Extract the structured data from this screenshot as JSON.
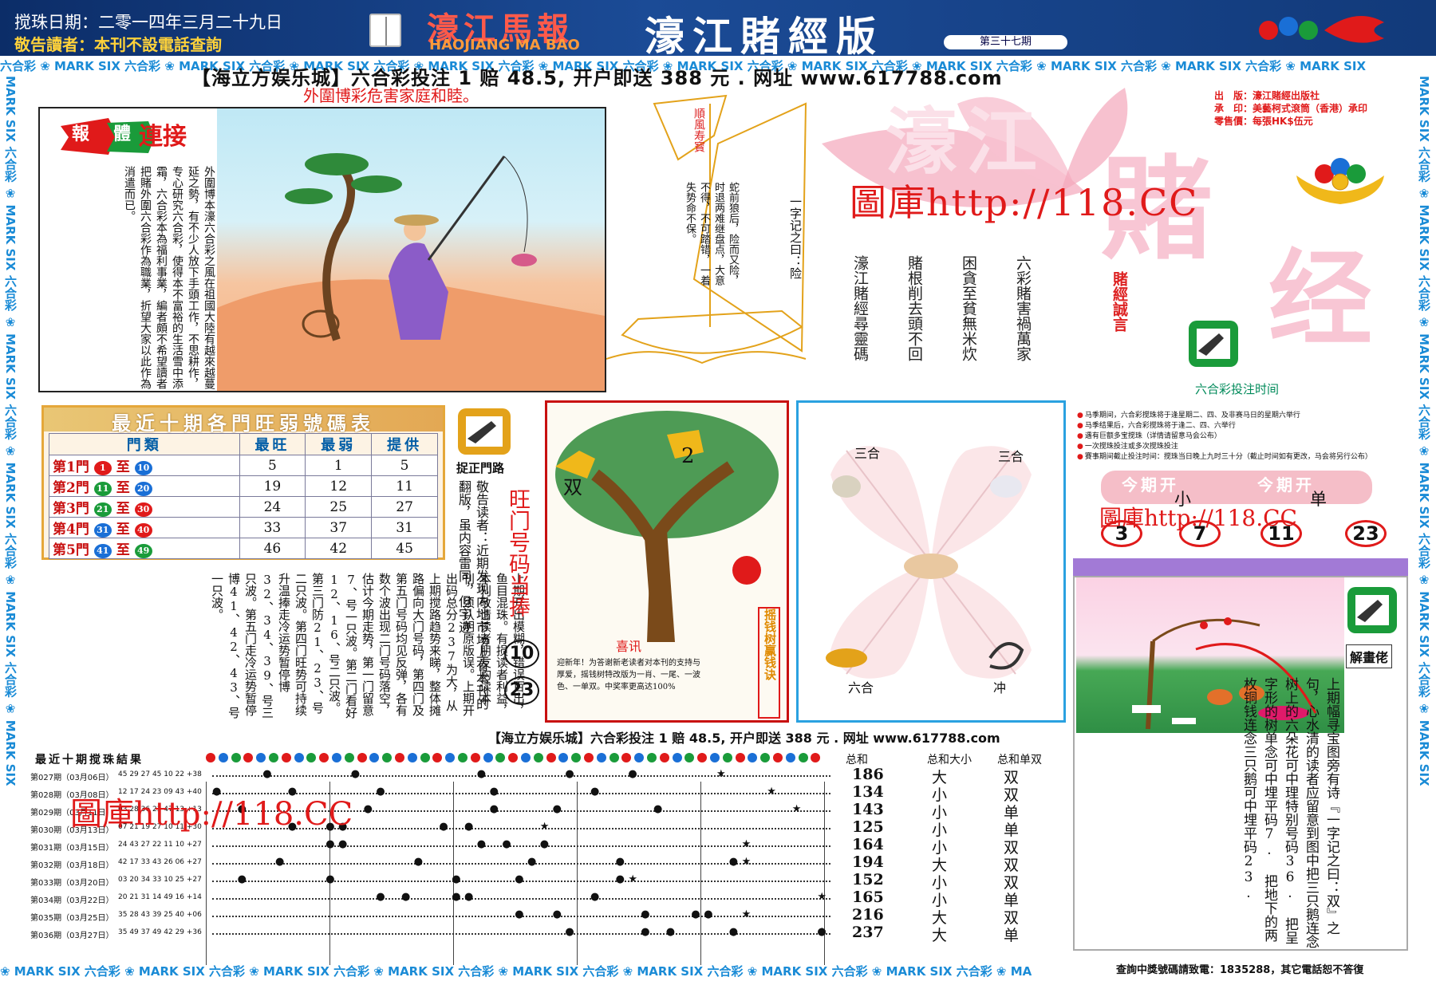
{
  "header": {
    "date": "搅珠日期：二零一四年三月二十九日",
    "warning_prefix": "敬告讀者：",
    "warning_text": "本刊不設電話查詢",
    "logo_name": "濠江馬報",
    "logo_pinyin": "HAOJIANG MA BAO",
    "edition": "濠江賭經版",
    "issue": "第三十七期"
  },
  "strips": {
    "top": "六合彩 ❀ MARK SIX 六合彩 ❀ MARK SIX 六合彩 ❀ MARK SIX 六合彩 ❀ MARK SIX 六合彩 ❀ MARK SIX 六合彩 ❀ MARK SIX 六合彩 ❀ MARK SIX 六合彩 ❀ MARK SIX 六合彩 ❀ MARK SIX 六合彩 ❀ MARK SIX 六合彩 ❀ MARK SIX",
    "bottom": "❀ MARK SIX 六合彩 ❀ MARK SIX 六合彩 ❀ MARK SIX 六合彩 ❀ MARK SIX 六合彩 ❀ MARK SIX 六合彩 ❀ MARK SIX 六合彩 ❀ MARK SIX 六合彩 ❀ MARK SIX 六合彩 ❀ MA",
    "side": "MARK SIX 六合彩 ❀ MARK SIX 六合彩 ❀ MARK SIX 六合彩 ❀ MARK SIX 六合彩 ❀ MARK SIX 六合彩 ❀ MARK SIX"
  },
  "ad_top": "【海立方娱乐城】六合彩投注 1 赔 48.5, 开户即送 388 元 . 网址 www.617788.com",
  "subhead": "外圍博彩危害家庭和睦。",
  "comic": {
    "tag_a": "報",
    "tag_b": "體",
    "tag_c": "連接",
    "text": "外圍博本濠六合彩之風在祖國大陸有越來越蔓延之勢，有不少人放下手頭工作，不思耕作，专心研究六合彩，使得本不富裕的生活雪中添霜，六合彩本為福利事業，編者頗不希望讀者把賭外圍六合彩作為職業，折望大家以此作為消遣而已。"
  },
  "boat": {
    "flag": "順風寿寳",
    "text1": "一字记之曰：险",
    "text2": "蛇前狼后，险而又险，时退两难继盘点，大意不得，不可踏错，一着失势命不保。"
  },
  "masthead": {
    "pub_label1": "出　版：",
    "pub_value1": "濠江賭經出版社",
    "pub_label2": "承　印：",
    "pub_value2": "美藝柯式滾筒（香港）承印",
    "pub_label3": "零售價：",
    "pub_value3": "每張HK$伍元",
    "big_a": "濠江",
    "big_b": "賭",
    "big_c": "经",
    "watermark": "圖庫http://118.CC",
    "poem": [
      "六彩賭害禍萬家",
      "困貪至貧無米炊",
      "賭根削去頭不回",
      "濠江賭經尋靈碼"
    ],
    "poem_label": "賭經誠言",
    "bet_time": "六合彩投注时间"
  },
  "stats": {
    "title": "最近十期各門旺弱號碼表",
    "headers": [
      "門類",
      "最旺",
      "最弱",
      "提供"
    ],
    "zhi": "至",
    "rows": [
      {
        "gate": "第1門",
        "from": "1",
        "to": "10",
        "hot": "5",
        "cold": "1",
        "pick": "5",
        "c1": "#e01a1a",
        "c2": "#1a6fd6"
      },
      {
        "gate": "第2門",
        "from": "11",
        "to": "20",
        "hot": "19",
        "cold": "12",
        "pick": "11",
        "c1": "#1a9b3a",
        "c2": "#1a6fd6"
      },
      {
        "gate": "第3門",
        "from": "21",
        "to": "30",
        "hot": "24",
        "cold": "25",
        "pick": "27",
        "c1": "#1a9b3a",
        "c2": "#e01a1a"
      },
      {
        "gate": "第4門",
        "from": "31",
        "to": "40",
        "hot": "33",
        "cold": "37",
        "pick": "31",
        "c1": "#1a6fd6",
        "c2": "#e01a1a"
      },
      {
        "gate": "第5門",
        "from": "41",
        "to": "49",
        "hot": "46",
        "cold": "42",
        "pick": "45",
        "c1": "#1a6fd6",
        "c2": "#1a9b3a"
      }
    ]
  },
  "hand_label": "捉正門路",
  "mid_text": "上期开出模糊，错误百出，鱼目混珠。有损读者利益，本刊敬请读者朋友购读本刊，须认明原版误。上期开出码总分237为大，从上期搅路趋势来睇，整体摊路偏向大门号码，第四门及第五门号码均见反弹，各有数个波出现二门号码落空，估计今期走势，第一门留意7、号一只波。第二门看好12、16、号二只波。第三门防21、23、号二只波。第四门旺势可持续升温捧走冷运势暂停博32、34、39、号三只波。第五门走冷运势暂停博41、42、43、号一只波。",
  "notice_text": "敬告读者：近期发现内地市场上有本刊的翻版，虽内容雷同，但字迹",
  "hot": {
    "title": "旺门号码当捧",
    "n1": "10",
    "n2": "23"
  },
  "tree": {
    "label_a": "双",
    "label_b": "2",
    "cap_title": "喜讯",
    "cap_text": "迎新年！为答谢新老读者对本刊的支持与厚爱，摇钱树特改版为一肖、一尾、一波色、一单双。中奖率更高达100%",
    "side": "摇钱树赢钱诀"
  },
  "heart": {
    "tl": "三合",
    "tr": "三合",
    "bl": "六合",
    "br": "冲"
  },
  "bet_notes": [
    "马季期间，六合彩搅珠将于逢星期二、四、及非赛马日的星期六举行",
    "马季结果后，六合彩搅珠将于逢二、四、六举行",
    "遇有巨额多宝搅珠（详情请留意马会公布）",
    "一次搅珠投注或多次搅珠投注",
    "賽事期间截止投注时间：搅珠当日晚上九时三十分（截止时间如有更改，马会将另行公布）"
  ],
  "open": {
    "label": "今期开",
    "val1": "小",
    "val2": "单",
    "watermark": "圖庫http://118.CC",
    "nums": [
      "3",
      "7",
      "11",
      "23"
    ]
  },
  "riddle": {
    "label": "解畫佬",
    "text": "上期幅寻宝图旁有诗『一字记之曰：双』之句，心水清的读者应留意到图中把三只鹅连念树上的六朵花可中理特别号码36. 把呈字形的树单念可中埋平码7. 把地下的两枚铜钱连念三只鹅可中埋平码23."
  },
  "results": {
    "head": "最近十期搅珠結果",
    "col_sum": "总和",
    "col_bs": "总和大小",
    "col_oe": "总和单双",
    "rows": [
      {
        "label": "第027期（03月06日）",
        "nums": "45 29 27 45 10 22 +38",
        "sum": "186",
        "bs": "大",
        "oe": "双"
      },
      {
        "label": "第028期（03月08日）",
        "nums": "12 17 24 23 09 43 +40",
        "sum": "134",
        "bs": "小",
        "oe": "双"
      },
      {
        "label": "第029期（03月11日）",
        "nums": "03 28 36 23 47 13 +13",
        "sum": "143",
        "bs": "小",
        "oe": "单"
      },
      {
        "label": "第030期（03月13日）",
        "nums": "07 21 19 27 10 11 +30",
        "sum": "125",
        "bs": "小",
        "oe": "单"
      },
      {
        "label": "第031期（03月15日）",
        "nums": "24 43 27 22 11 10 +27",
        "sum": "164",
        "bs": "小",
        "oe": "双"
      },
      {
        "label": "第032期（03月18日）",
        "nums": "42 17 33 43 26 06 +27",
        "sum": "194",
        "bs": "大",
        "oe": "双"
      },
      {
        "label": "第033期（03月20日）",
        "nums": "03 20 34 33 10 25 +27",
        "sum": "152",
        "bs": "小",
        "oe": "双"
      },
      {
        "label": "第034期（03月22日）",
        "nums": "20 21 31 14 49 16 +14",
        "sum": "165",
        "bs": "小",
        "oe": "单"
      },
      {
        "label": "第035期（03月25日）",
        "nums": "35 28 43 39 25 40 +06",
        "sum": "216",
        "bs": "大",
        "oe": "双"
      },
      {
        "label": "第036期（03月27日）",
        "nums": "35 49 37 49 42 29 +36",
        "sum": "237",
        "bs": "大",
        "oe": "单"
      }
    ],
    "watermark": "圖庫http://118.CC"
  },
  "ad_mid": "【海立方娱乐城】六合彩投注 1 赔 48.5, 开户即送 388 元 . 网址 www.617788.com",
  "hotline": "查詢中獎號碼請致電：1835288，其它電話恕不答復"
}
